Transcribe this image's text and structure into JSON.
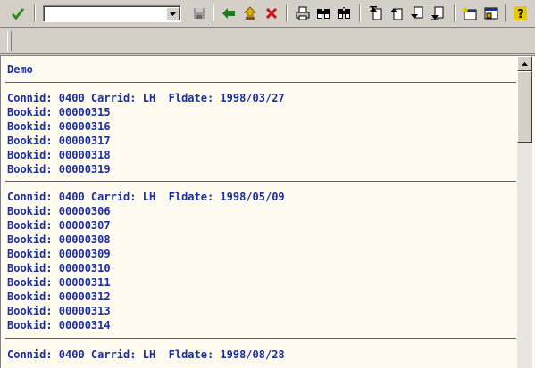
{
  "toolbar": {
    "buttons": [
      {
        "name": "enter-check-icon",
        "glyph": "✔",
        "color": "#2e8b1e"
      },
      {
        "name": "save-icon"
      },
      {
        "name": "back-arrow-icon"
      },
      {
        "name": "exit-up-arrow-icon"
      },
      {
        "name": "cancel-x-icon",
        "glyph": "✕",
        "color": "#d01010"
      },
      {
        "name": "print-icon"
      },
      {
        "name": "find-icon"
      },
      {
        "name": "find-next-icon"
      },
      {
        "name": "first-page-icon"
      },
      {
        "name": "previous-page-icon"
      },
      {
        "name": "next-page-icon"
      },
      {
        "name": "last-page-icon"
      },
      {
        "name": "new-session-icon"
      },
      {
        "name": "create-shortcut-icon"
      },
      {
        "name": "help-icon",
        "glyph": "?"
      }
    ],
    "command_field": {
      "value": "",
      "placeholder": ""
    }
  },
  "list": {
    "header": "Demo",
    "groups": [
      {
        "heading": "Connid: 0400 Carrid: LH  Fldate: 1998/03/27",
        "rows": [
          "Bookid: 00000315",
          "Bookid: 00000316",
          "Bookid: 00000317",
          "Bookid: 00000318",
          "Bookid: 00000319"
        ]
      },
      {
        "heading": "Connid: 0400 Carrid: LH  Fldate: 1998/05/09",
        "rows": [
          "Bookid: 00000306",
          "Bookid: 00000307",
          "Bookid: 00000308",
          "Bookid: 00000309",
          "Bookid: 00000310",
          "Bookid: 00000311",
          "Bookid: 00000312",
          "Bookid: 00000313",
          "Bookid: 00000314"
        ]
      },
      {
        "heading": "Connid: 0400 Carrid: LH  Fldate: 1998/08/28",
        "rows": []
      }
    ]
  },
  "colors": {
    "list_text": "#1a2ea0",
    "list_background": "#fffbf0",
    "chrome": "#d4d0c8"
  }
}
